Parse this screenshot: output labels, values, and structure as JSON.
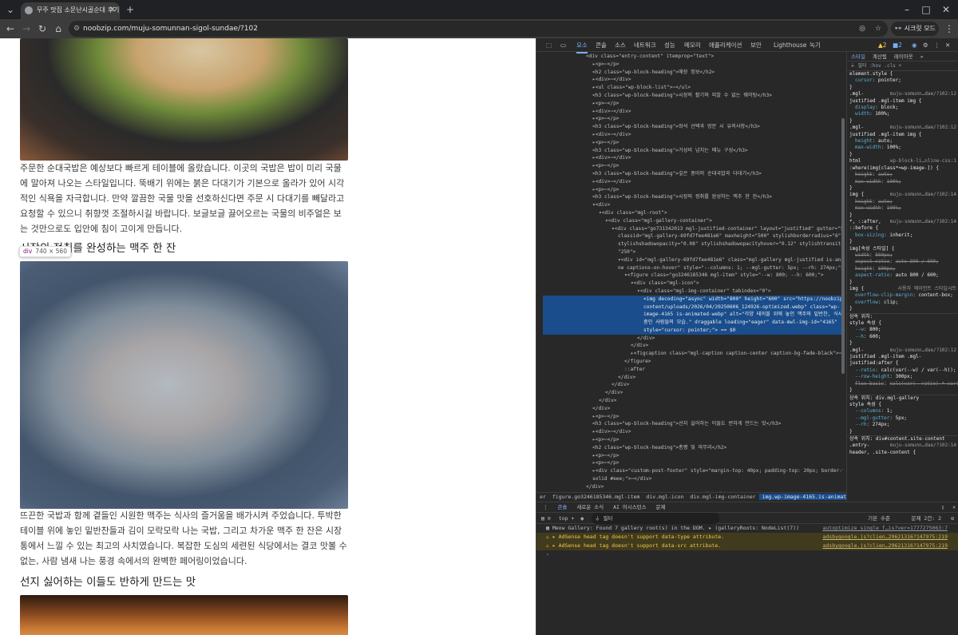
{
  "browser": {
    "tab_title": "무주 맛집 소문난시골순대 후기",
    "new_tab": "+",
    "url": "noobzip.com/muju-somunnan-sigol-sundae/?102",
    "incognito_label": "시크릿 모드",
    "window_controls": [
      "–",
      "□",
      "✕"
    ]
  },
  "page": {
    "para1": "주문한 순대국밥은 예상보다 빠르게 테이블에 올랐습니다. 이곳의 국밥은 밥이 미리 국물에 말아져 나오는 스타일입니다. 뚝배기 위에는 붉은 다대기가 기본으로 올라가 있어 시각적인 식욕을 자극합니다. 만약 깔끔한 국물 맛을 선호하신다면 주문 시 다대기를 빼달라고 요청할 수 있으니 취향껏 조절하시길 바랍니다. 보글보글 끓어오르는 국물의 비주얼은 보는 것만으로도 입안에 침이 고이게 만듭니다.",
    "heading2": "시장의 정취를 완성하는 맥주 한 잔",
    "inspect_tag": "div",
    "inspect_size": "740 × 560",
    "para2": "뜨끈한 국밥과 함께 곁들인 시원한 맥주는 식사의 즐거움을 배가시켜 주었습니다. 투박한 테이블 위에 놓인 밑반찬들과 김이 모락모락 나는 국밥, 그리고 차가운 맥주 한 잔은 시장통에서 느낄 수 있는 최고의 사치였습니다. 복잡한 도심의 세련된 식당에서는 결코 맛볼 수 없는, 사람 냄새 나는 풍경 속에서의 완벽한 페어링이었습니다.",
    "heading3": "선지 싫어하는 이들도 반하게 만드는 맛"
  },
  "devtools": {
    "tabs": [
      "요소",
      "콘솔",
      "소스",
      "네트워크",
      "성능",
      "메모리",
      "애플리케이션",
      "보안",
      "Lighthouse",
      "녹기"
    ],
    "warn_count": "2",
    "err_count": "2",
    "element_lines": [
      {
        "t": "<div class=\"entry-content\" itemprop=\"text\">",
        "i": 0
      },
      {
        "t": "▸<p>⋯</p>",
        "i": 1
      },
      {
        "t": "<h2 class=\"wp-block-heading\">매장 정보</h2>",
        "i": 1
      },
      {
        "t": "▸<div>⋯</div>",
        "i": 1
      },
      {
        "t": "▸<ul class=\"wp-block-list\">⋯</ul>",
        "i": 1
      },
      {
        "t": "<h3 class=\"wp-block-heading\">시장의 활기와 피할 수 없는 웨이팅</h3>",
        "i": 1
      },
      {
        "t": "▸<p>⋯</p>",
        "i": 1
      },
      {
        "t": "▸<div>⋯</div>",
        "i": 1
      },
      {
        "t": "▸<p>⋯</p>",
        "i": 1
      },
      {
        "t": "<h3 class=\"wp-block-heading\">좌석 선택과 방문 시 유의사항</h3>",
        "i": 1
      },
      {
        "t": "▸<div>⋯</div>",
        "i": 1
      },
      {
        "t": "▸<p>⋯</p>",
        "i": 1
      },
      {
        "t": "<h3 class=\"wp-block-heading\">가성비 넘치는 메뉴 구성</h3>",
        "i": 1
      },
      {
        "t": "▸<div>⋯</div>",
        "i": 1
      },
      {
        "t": "▸<p>⋯</p>",
        "i": 1
      },
      {
        "t": "<h3 class=\"wp-block-heading\">깊은 풍미의 순대국밥과 다대기</h3>",
        "i": 1
      },
      {
        "t": "▸<div>⋯</div>",
        "i": 1
      },
      {
        "t": "▸<p>⋯</p>",
        "i": 1
      },
      {
        "t": "<h3 class=\"wp-block-heading\">시장의 정취를 완성하는 맥주 한 잔</h3>",
        "i": 1
      },
      {
        "t": "▾<div>",
        "i": 1
      },
      {
        "t": "▾<div class=\"mgl-root\">",
        "i": 2
      },
      {
        "t": "▾<div class=\"mgl-gallery-container\">",
        "i": 3
      },
      {
        "t": "▾<div class=\"go731342013 mgl-justified-container\" layout=\"justified\" gutter=\"5\"",
        "i": 4
      },
      {
        "t": "classid=\"mgl-gallery-69fd7fee481e6\" maxheight=\"500\" stylishborderradius=\"6\"",
        "i": 5
      },
      {
        "t": "stylishshadowopacity=\"0.08\" stylishshadowopacityhover=\"0.12\" stylishtransitionspeed=",
        "i": 5
      },
      {
        "t": "\"250\">",
        "i": 5
      },
      {
        "t": "▾<div id=\"mgl-gallery-69fd7fee481e6\" class=\"mgl-gallery mgl-justified is-animated no",
        "i": 5
      },
      {
        "t": "ne captions-on-hover\" style=\"--columns: 1; --mgl-gutter: 5px; --rh: 274px;\">",
        "i": 5
      },
      {
        "t": "▾<figure class=\"go3246185346 mgl-item\" style=\"--w: 800; --h: 600;\">",
        "i": 6
      },
      {
        "t": "▾<div class=\"mgl-icon\">",
        "i": 7
      },
      {
        "t": "▾<div class=\"mgl-img-container\" tabindex=\"0\">",
        "i": 8
      },
      {
        "t": "<img decoding=\"async\" width=\"800\" height=\"600\" src=\"https://noobzip.com/wp-",
        "i": 9,
        "sel": true
      },
      {
        "t": "content/uploads/2026/04/20250606_124926-optimized.webp\" class=\"wp-",
        "i": 9,
        "sel": true
      },
      {
        "t": "image-4165 is-animated-webp\" alt=\"각양 테이블 위에 놓인 맥주와 밑반찬, 식사",
        "i": 9,
        "sel": true
      },
      {
        "t": "중인 사람들의 모습.\" draggable loading=\"eager\" data-mwl-img-id=\"4165\"",
        "i": 9,
        "sel": true
      },
      {
        "t": "style=\"cursor: pointer;\"> == $0",
        "i": 9,
        "sel": true
      },
      {
        "t": "</div>",
        "i": 8
      },
      {
        "t": "</div>",
        "i": 7
      },
      {
        "t": "▸<figcaption class=\"mgl-caption caption-center caption-bg-fade-black\">⋯</figcaption>",
        "i": 7
      },
      {
        "t": "</figure>",
        "i": 6
      },
      {
        "t": "::after",
        "i": 6
      },
      {
        "t": "</div>",
        "i": 5
      },
      {
        "t": "</div>",
        "i": 4
      },
      {
        "t": "</div>",
        "i": 3
      },
      {
        "t": "</div>",
        "i": 2
      },
      {
        "t": "</div>",
        "i": 1
      },
      {
        "t": "▸<p>⋯</p>",
        "i": 1
      },
      {
        "t": "<h3 class=\"wp-block-heading\">선지 싫어하는 이들도 반하게 만드는 맛</h3>",
        "i": 1
      },
      {
        "t": "▸<div>⋯</div>",
        "i": 1
      },
      {
        "t": "▸<p>⋯</p>",
        "i": 1
      },
      {
        "t": "<h2 class=\"wp-block-heading\">총평 및 마무리</h2>",
        "i": 1
      },
      {
        "t": "▸<p>⋯</p>",
        "i": 1
      },
      {
        "t": "▸<p>⋯</p>",
        "i": 1
      },
      {
        "t": "▸<div class=\"custom-post-footer\" style=\"margin-top: 40px; padding-top: 20px; border-top: 1px",
        "i": 1
      },
      {
        "t": "solid #eee;\">⋯</div>",
        "i": 1
      },
      {
        "t": "</div>",
        "i": 0
      },
      {
        "t": "▸<footer class=\"entry-meta\" aria-label=\"항목 메타\">⋯</footer>",
        "i": 0
      },
      {
        "t": "</div>",
        "i": 0
      }
    ],
    "breadcrumbs": [
      "er",
      "figure.go3246185346.mgl-item",
      "div.mgl-icon",
      "div.mgl-img-container",
      "img.wp-image-4165.is-animated-webp"
    ],
    "styles": {
      "tabs": [
        "스타일",
        "계산됨",
        "레이아웃",
        "»"
      ],
      "filter_placeholder": "필터",
      "filter_tags": ":hov .cls",
      "lines": [
        {
          "s": "element.style {"
        },
        {
          "p": "cursor",
          "v": "pointer;"
        },
        {
          "s": "}"
        },
        {
          "s": ".mgl-",
          "src": "muju-somunn…dae/?102:12"
        },
        {
          "s": "justified .mgl-item img {"
        },
        {
          "p": "display",
          "v": "block;"
        },
        {
          "p": "width",
          "v": "100%;"
        },
        {
          "s": "}"
        },
        {
          "s": ".mgl-",
          "src": "muju-somunn…dae/?102:12"
        },
        {
          "s": "justified .mgl-item img {"
        },
        {
          "p": "height",
          "v": "auto;"
        },
        {
          "p": "max-width",
          "v": "100%;"
        },
        {
          "s": "}"
        },
        {
          "s": "html",
          "src": "wp-block-li…nline-css:1"
        },
        {
          "s": ":where(img[class*=wp-image-]) {"
        },
        {
          "p": "height",
          "v": "auto;",
          "x": true
        },
        {
          "p": "max-width",
          "v": "100%;",
          "x": true
        },
        {
          "s": "}"
        },
        {
          "s": "img {",
          "src": "muju-somunn…dae/?102:14"
        },
        {
          "p": "height",
          "v": "auto;",
          "x": true
        },
        {
          "p": "max-width",
          "v": "100%;",
          "x": true
        },
        {
          "s": "}"
        },
        {
          "s": "*, ::after,",
          "src": "muju-somunn…dae/?102:14"
        },
        {
          "s": "::before {"
        },
        {
          "p": "box-sizing",
          "v": "inherit;"
        },
        {
          "s": "}"
        },
        {
          "s": "img[속성 스타일] {"
        },
        {
          "p": "width",
          "v": "800px;",
          "x": true
        },
        {
          "p": "aspect-ratio",
          "v": "auto 800 / 600;",
          "x": true
        },
        {
          "p": "height",
          "v": "600px;",
          "x": true
        },
        {
          "p": "aspect-ratio",
          "v": "auto 800 / 600;"
        },
        {
          "s": "}"
        },
        {
          "s": "img {",
          "src": "사용자 에이전트 스타일시트"
        },
        {
          "p": "overflow-clip-margin",
          "v": "content-box;"
        },
        {
          "p": "overflow",
          "v": "clip;"
        },
        {
          "s": "}"
        },
        {
          "s": "상속 위치:",
          "h": true
        },
        {
          "s": "style 속성 {"
        },
        {
          "p": "--w",
          "v": "800;"
        },
        {
          "p": "--h",
          "v": "600;"
        },
        {
          "s": "}"
        },
        {
          "s": ".mgl-",
          "src": "muju-somunn…dae/?102:12"
        },
        {
          "s": "justified .mgl-item .mgl-"
        },
        {
          "s": "justified:after {"
        },
        {
          "p": "--ratio",
          "v": "calc(var(--w) / var(--h));"
        },
        {
          "p": "--row-height",
          "v": "300px;"
        },
        {
          "p": "flex-basis",
          "v": "calc(var(--ratio) * var(--rh));",
          "x": true
        },
        {
          "s": "}"
        },
        {
          "s": "상속 위치: div.mgl-gallery",
          "h": true
        },
        {
          "s": "style 속성 {"
        },
        {
          "p": "--columns",
          "v": "1;"
        },
        {
          "p": "--mgl-gutter",
          "v": "5px;"
        },
        {
          "p": "--rh",
          "v": "274px;"
        },
        {
          "s": "}"
        },
        {
          "s": "상속 위치: div#content.site-content",
          "h": true
        },
        {
          "s": ".entry-",
          "src": "muju-somunn…dae/?102:14"
        },
        {
          "s": "header, .site-content {"
        }
      ]
    },
    "console": {
      "tabs": [
        "콘솔",
        "새로운 소식",
        "AI 어시스턴스",
        "문제"
      ],
      "context": "top",
      "filter": "필터",
      "level": "기본 수준",
      "issues": "문제 2건: 2",
      "messages": [
        {
          "type": "log",
          "text": "Meow Gallery: Found 7 gallery root(s) in the DOM.  ▸ (galleryRoots: NodeList(7))",
          "src": "autoptimize_single_f…is?ver=1777275063:7"
        },
        {
          "type": "warn",
          "text": "▸ AdSense head tag doesn't support data-type attribute.",
          "src": "adsbygoogle.js?clien…29621316?147975:219"
        },
        {
          "type": "warn",
          "text": "▸ AdSense head tag doesn't support data-src attribute.",
          "src": "adsbygoogle.js?clien…29621316?147975:219"
        }
      ],
      "prompt": "›"
    }
  }
}
